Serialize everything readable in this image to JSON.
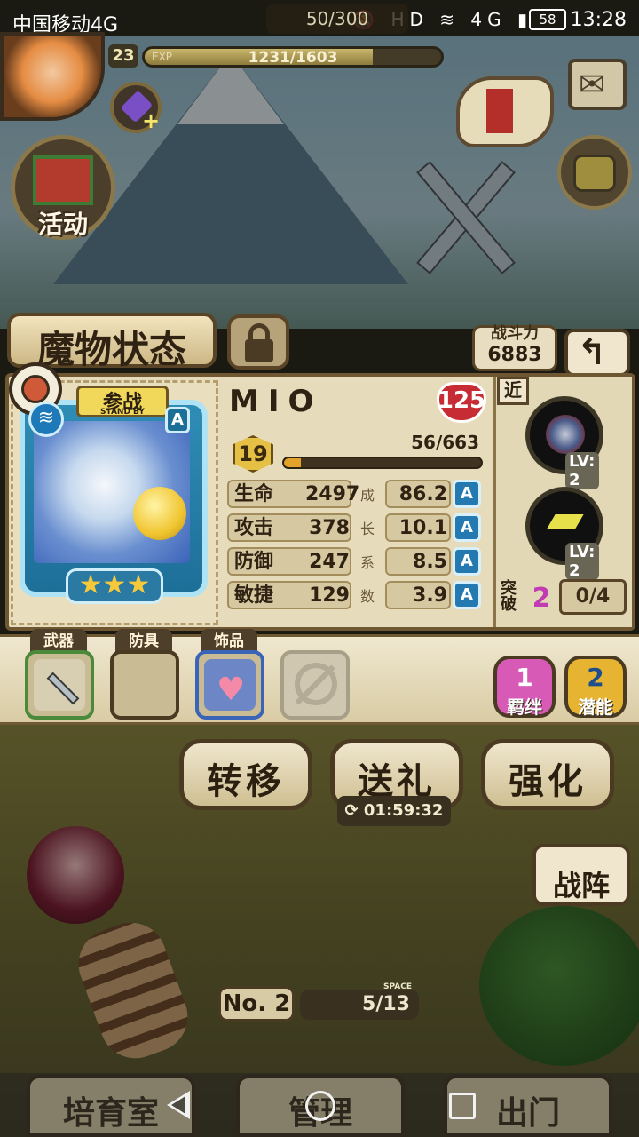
{
  "status_bar": {
    "carrier": "中国移动4G",
    "icons": "🔕 HD ≋ 4G ▮",
    "battery": "58",
    "time": "13:28"
  },
  "hud": {
    "stamina": "50/300",
    "player_level": "23",
    "exp_label": "EXP",
    "exp_text": "1231/1603",
    "exp_progress": 0.768,
    "activity_label": "活动"
  },
  "screen": {
    "title": "魔物状态",
    "power_label": "战斗力",
    "power_value": "6883"
  },
  "monster": {
    "standby_cn": "参战",
    "standby_en": "STAND BY",
    "rank": "A",
    "stars": "★★★",
    "name": "MIO",
    "heart_level": "125",
    "level": "19",
    "xp_text": "56/663",
    "xp_progress": 0.085,
    "growth_chars": [
      "成",
      "长",
      "系",
      "数"
    ],
    "stats": [
      {
        "label": "生命",
        "value": "2497",
        "growth": "86.2",
        "grade": "A"
      },
      {
        "label": "攻击",
        "value": "378",
        "growth": "10.1",
        "grade": "A"
      },
      {
        "label": "防御",
        "value": "247",
        "growth": "8.5",
        "grade": "A"
      },
      {
        "label": "敏捷",
        "value": "129",
        "growth": "3.9",
        "grade": "A"
      }
    ]
  },
  "skills": {
    "melee_tag": "近",
    "skill1_lv": "LV: 2",
    "skill2_lv": "LV: 2",
    "break_label": "突破",
    "break_value": "2",
    "break_progress": "0/4"
  },
  "equipment": {
    "weapon_tab": "武器",
    "armor_tab": "防具",
    "accessory_tab": "饰品"
  },
  "buttons": {
    "bond_count": "1",
    "bond_label": "羁绊",
    "potential_count": "2",
    "potential_label": "潜能",
    "transfer": "转移",
    "gift": "送礼",
    "enhance": "强化",
    "gift_timer": "01:59:32"
  },
  "bottom": {
    "formation": "战阵",
    "no_label": "No. 2",
    "space_label": "SPACE",
    "space_value": "5/13",
    "tab_breed": "培育室",
    "tab_manage": "管理",
    "tab_go_out": "出门"
  },
  "colors": {
    "accent_gold": "#e6bf45",
    "frame_blue": "#1d6f98",
    "heart_red": "#c72b33",
    "break_purple": "#c13bb4"
  }
}
